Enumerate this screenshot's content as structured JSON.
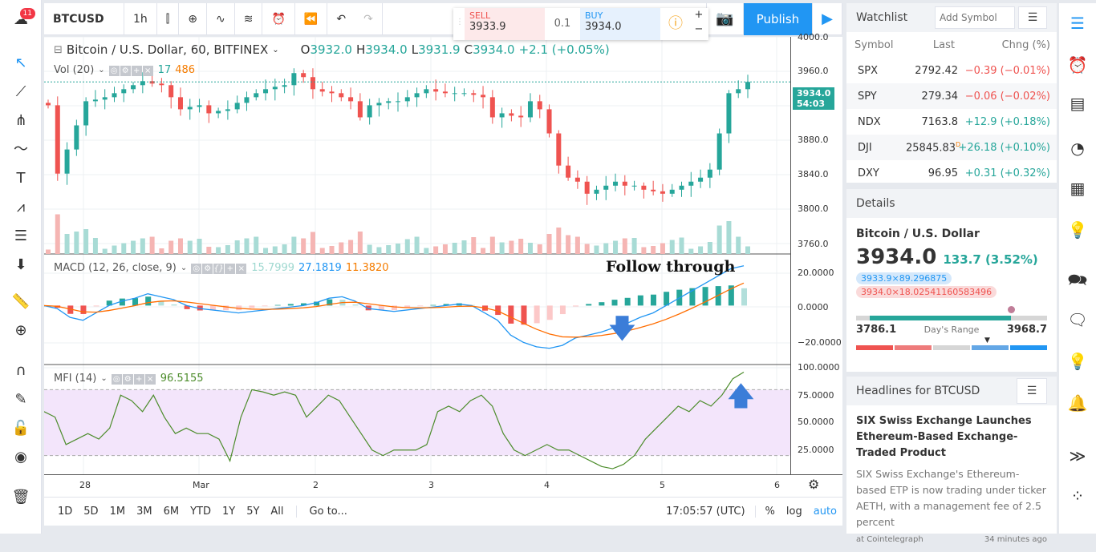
{
  "app": {
    "notification_count": "11"
  },
  "toolbar": {
    "symbol": "BTCUSD",
    "interval": "1h",
    "publish": "Publish"
  },
  "trade": {
    "sell_label": "SELL",
    "sell_price": "3933.9",
    "qty": "0.1",
    "buy_label": "BUY",
    "buy_price": "3934.0"
  },
  "legend": {
    "title": "Bitcoin / U.S. Dollar, 60, BITFINEX",
    "o_label": "O",
    "o": "3932.0",
    "h_label": "H",
    "h": "3934.0",
    "l_label": "L",
    "l": "3931.9",
    "c_label": "C",
    "c": "3934.0",
    "change": "+2.1 (+0.05%)",
    "vol": "Vol (20)",
    "vol_v1": "17",
    "vol_v2": "486",
    "macd": "MACD (12, 26, close, 9)",
    "macd_v1": "15.7999",
    "macd_v2": "27.1819",
    "macd_v3": "11.3820",
    "mfi": "MFI (14)",
    "mfi_v": "96.5155"
  },
  "annotation": {
    "text": "Follow through"
  },
  "price_axis": {
    "ticks": [
      "4000.0",
      "3960.0",
      "3880.0",
      "3840.0",
      "3800.0",
      "3760.0"
    ],
    "last_price": "3934.0",
    "countdown": "54:03",
    "macd_ticks": [
      "20.0000",
      "0.0000",
      "−20.0000"
    ],
    "mfi_ticks": [
      "100.0000",
      "75.0000",
      "50.0000",
      "25.0000"
    ]
  },
  "time_axis": {
    "ticks": [
      "28",
      "Mar",
      "2",
      "3",
      "4",
      "5",
      "6"
    ]
  },
  "bottom": {
    "ranges": [
      "1D",
      "5D",
      "1M",
      "3M",
      "6M",
      "YTD",
      "1Y",
      "5Y",
      "All"
    ],
    "goto": "Go to...",
    "clock": "17:05:57 (UTC)",
    "pct": "%",
    "log": "log",
    "auto": "auto"
  },
  "watchlist": {
    "title": "Watchlist",
    "placeholder": "Add Symbol",
    "headers": [
      "Symbol",
      "Last",
      "Chng (%)"
    ],
    "rows": [
      {
        "symbol": "SPX",
        "last": "2792.42",
        "change": "−0.39 (−0.01%)",
        "dir": "dn"
      },
      {
        "symbol": "SPY",
        "last": "279.34",
        "change": "−0.06 (−0.02%)",
        "dir": "dn"
      },
      {
        "symbol": "NDX",
        "last": "7163.8",
        "change": "+12.9 (+0.18%)",
        "dir": "up"
      },
      {
        "symbol": "DJI",
        "last": "25845.83",
        "flag": "D",
        "change": "+26.18 (+0.10%)",
        "dir": "up"
      },
      {
        "symbol": "DXY",
        "last": "96.95",
        "change": "+0.31 (+0.32%)",
        "dir": "up"
      }
    ]
  },
  "details": {
    "title": "Details",
    "name": "Bitcoin / U.S. Dollar",
    "price": "3934.0",
    "change": "133.7 (3.52%)",
    "bid": "3933.9×89.296875",
    "ask": "3934.0×18.02541160583496",
    "low": "3786.1",
    "range_label": "Day's Range",
    "high": "3968.7",
    "range_position": 0.81
  },
  "headlines": {
    "title": "Headlines for BTCUSD",
    "headline": "SIX Swiss Exchange Launches Ethereum-Based Exchange-Traded Product",
    "summary": "SIX Swiss Exchange's Ethereum-based ETP is now trading under ticker AETH, with a management fee of 2.5 percent",
    "source": "at Cointelegraph",
    "time": "34 minutes ago"
  },
  "colors": {
    "up": "#26a69a",
    "down": "#ef5350",
    "accent": "#2196f3",
    "macd": "#2196f3",
    "signal": "#ff6d00",
    "mfi": "#4c8c2b",
    "mfi_band": "#f3e5fb"
  },
  "chart_data": {
    "type": "candlestick",
    "price_closes": [
      3905,
      3820,
      3850,
      3880,
      3910,
      3912,
      3915,
      3920,
      3925,
      3930,
      3935,
      3932,
      3930,
      3915,
      3900,
      3903,
      3905,
      3895,
      3898,
      3900,
      3908,
      3915,
      3920,
      3925,
      3928,
      3930,
      3945,
      3940,
      3925,
      3922,
      3920,
      3915,
      3910,
      3890,
      3905,
      3908,
      3910,
      3910,
      3915,
      3920,
      3925,
      3922,
      3920,
      3920,
      3920,
      3918,
      3915,
      3890,
      3895,
      3892,
      3890,
      3910,
      3900,
      3870,
      3830,
      3815,
      3810,
      3795,
      3800,
      3805,
      3810,
      3805,
      3805,
      3800,
      3798,
      3795,
      3800,
      3805,
      3810,
      3815,
      3825,
      3870,
      3920,
      3925,
      3934
    ],
    "macd": [
      0,
      -2,
      -8,
      -10,
      -5,
      0,
      3,
      5,
      8,
      6,
      4,
      0,
      -2,
      -3,
      -4,
      -5,
      -4,
      -3,
      -2,
      -1,
      0,
      2,
      5,
      6,
      3,
      -2,
      -3,
      -4,
      -3,
      -2,
      -1,
      0,
      1,
      0,
      -5,
      -10,
      -20,
      -25,
      -28,
      -29,
      -27,
      -22,
      -20,
      -18,
      -15,
      -12,
      -8,
      -5,
      0,
      5,
      10,
      15,
      20,
      25,
      27
    ],
    "mfi": [
      60,
      55,
      30,
      35,
      40,
      35,
      45,
      75,
      70,
      60,
      75,
      55,
      40,
      45,
      40,
      40,
      35,
      15,
      55,
      80,
      78,
      75,
      78,
      75,
      55,
      65,
      75,
      70,
      55,
      40,
      25,
      20,
      25,
      25,
      25,
      30,
      60,
      65,
      60,
      70,
      75,
      65,
      40,
      25,
      20,
      25,
      30,
      25,
      25,
      20,
      15,
      10,
      8,
      12,
      20,
      35,
      45,
      55,
      65,
      60,
      70,
      65,
      75,
      90,
      96
    ],
    "price_range": [
      3740,
      4010
    ],
    "macd_range": [
      -40,
      35
    ],
    "mfi_band": [
      20,
      80
    ]
  }
}
